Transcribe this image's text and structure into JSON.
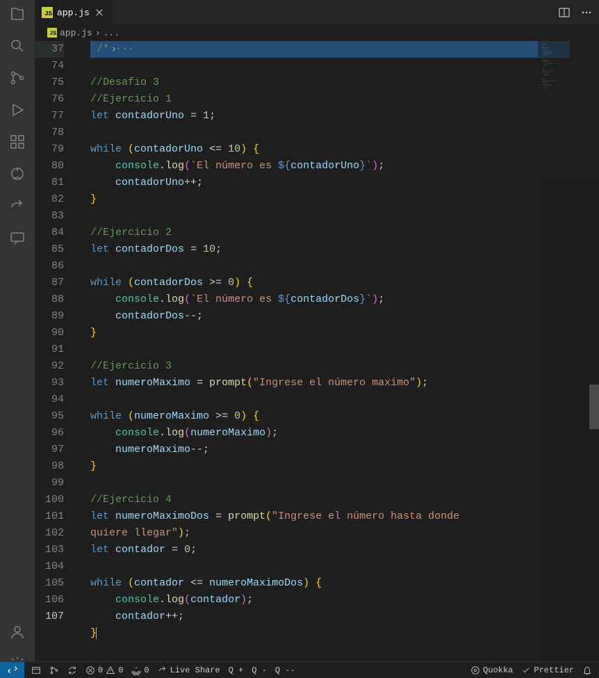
{
  "tab": {
    "name": "app.js"
  },
  "breadcrumb": {
    "file": "app.js",
    "sep": "›",
    "more": "..."
  },
  "lines": [
    {
      "n": 37,
      "tokens": [
        [
          "fold",
          "›"
        ],
        [
          "cm",
          " /* "
        ],
        [
          "cm",
          "···"
        ]
      ]
    },
    {
      "n": 74,
      "tokens": []
    },
    {
      "n": 75,
      "tokens": [
        [
          "cm",
          "//Desafio 3"
        ]
      ]
    },
    {
      "n": 76,
      "tokens": [
        [
          "cm",
          "//Ejercicio 1"
        ]
      ]
    },
    {
      "n": 77,
      "tokens": [
        [
          "kw",
          "let"
        ],
        [
          "p",
          " "
        ],
        [
          "var",
          "contadorUno"
        ],
        [
          "p",
          " = "
        ],
        [
          "num",
          "1"
        ],
        [
          "p",
          ";"
        ]
      ]
    },
    {
      "n": 78,
      "tokens": []
    },
    {
      "n": 79,
      "tokens": [
        [
          "kw",
          "while"
        ],
        [
          "p",
          " "
        ],
        [
          "br",
          "("
        ],
        [
          "var",
          "contadorUno"
        ],
        [
          "p",
          " <= "
        ],
        [
          "num",
          "10"
        ],
        [
          "br",
          ")"
        ],
        [
          "p",
          " "
        ],
        [
          "br",
          "{"
        ]
      ]
    },
    {
      "n": 80,
      "tokens": [
        [
          "p",
          "    "
        ],
        [
          "obj",
          "console"
        ],
        [
          "p",
          "."
        ],
        [
          "fn",
          "log"
        ],
        [
          "br2",
          "("
        ],
        [
          "str",
          "`El número es "
        ],
        [
          "kw",
          "${"
        ],
        [
          "tplv",
          "contadorUno"
        ],
        [
          "kw",
          "}"
        ],
        [
          "str",
          "`"
        ],
        [
          "br2",
          ")"
        ],
        [
          "p",
          ";"
        ]
      ]
    },
    {
      "n": 81,
      "tokens": [
        [
          "p",
          "    "
        ],
        [
          "var",
          "contadorUno"
        ],
        [
          "p",
          "++;"
        ]
      ]
    },
    {
      "n": 82,
      "tokens": [
        [
          "br",
          "}"
        ]
      ]
    },
    {
      "n": 83,
      "tokens": []
    },
    {
      "n": 84,
      "tokens": [
        [
          "cm",
          "//Ejercicio 2"
        ]
      ]
    },
    {
      "n": 85,
      "tokens": [
        [
          "kw",
          "let"
        ],
        [
          "p",
          " "
        ],
        [
          "var",
          "contadorDos"
        ],
        [
          "p",
          " = "
        ],
        [
          "num",
          "10"
        ],
        [
          "p",
          ";"
        ]
      ]
    },
    {
      "n": 86,
      "tokens": []
    },
    {
      "n": 87,
      "tokens": [
        [
          "kw",
          "while"
        ],
        [
          "p",
          " "
        ],
        [
          "br",
          "("
        ],
        [
          "var",
          "contadorDos"
        ],
        [
          "p",
          " >= "
        ],
        [
          "num",
          "0"
        ],
        [
          "br",
          ")"
        ],
        [
          "p",
          " "
        ],
        [
          "br",
          "{"
        ]
      ]
    },
    {
      "n": 88,
      "tokens": [
        [
          "p",
          "    "
        ],
        [
          "obj",
          "console"
        ],
        [
          "p",
          "."
        ],
        [
          "fn",
          "log"
        ],
        [
          "br2",
          "("
        ],
        [
          "str",
          "`El número es "
        ],
        [
          "kw",
          "${"
        ],
        [
          "tplv",
          "contadorDos"
        ],
        [
          "kw",
          "}"
        ],
        [
          "str",
          "`"
        ],
        [
          "br2",
          ")"
        ],
        [
          "p",
          ";"
        ]
      ]
    },
    {
      "n": 89,
      "tokens": [
        [
          "p",
          "    "
        ],
        [
          "var",
          "contadorDos"
        ],
        [
          "p",
          "--;"
        ]
      ]
    },
    {
      "n": 90,
      "tokens": [
        [
          "br",
          "}"
        ]
      ]
    },
    {
      "n": 91,
      "tokens": []
    },
    {
      "n": 92,
      "tokens": [
        [
          "cm",
          "//Ejercicio 3"
        ]
      ]
    },
    {
      "n": 93,
      "tokens": [
        [
          "kw",
          "let"
        ],
        [
          "p",
          " "
        ],
        [
          "var",
          "numeroMaximo"
        ],
        [
          "p",
          " = "
        ],
        [
          "fn",
          "prompt"
        ],
        [
          "br",
          "("
        ],
        [
          "str",
          "\"Ingrese el número maximo\""
        ],
        [
          "br",
          ")"
        ],
        [
          "p",
          ";"
        ]
      ]
    },
    {
      "n": 94,
      "tokens": []
    },
    {
      "n": 95,
      "tokens": [
        [
          "kw",
          "while"
        ],
        [
          "p",
          " "
        ],
        [
          "br",
          "("
        ],
        [
          "var",
          "numeroMaximo"
        ],
        [
          "p",
          " >= "
        ],
        [
          "num",
          "0"
        ],
        [
          "br",
          ")"
        ],
        [
          "p",
          " "
        ],
        [
          "br",
          "{"
        ]
      ]
    },
    {
      "n": 96,
      "tokens": [
        [
          "p",
          "    "
        ],
        [
          "obj",
          "console"
        ],
        [
          "p",
          "."
        ],
        [
          "fn",
          "log"
        ],
        [
          "br2",
          "("
        ],
        [
          "var",
          "numeroMaximo"
        ],
        [
          "br2",
          ")"
        ],
        [
          "p",
          ";"
        ]
      ]
    },
    {
      "n": 97,
      "tokens": [
        [
          "p",
          "    "
        ],
        [
          "var",
          "numeroMaximo"
        ],
        [
          "p",
          "--;"
        ]
      ]
    },
    {
      "n": 98,
      "tokens": [
        [
          "br",
          "}"
        ]
      ]
    },
    {
      "n": 99,
      "tokens": []
    },
    {
      "n": 100,
      "tokens": [
        [
          "cm",
          "//Ejercicio 4"
        ]
      ]
    },
    {
      "n": 101,
      "tokens": [
        [
          "kw",
          "let"
        ],
        [
          "p",
          " "
        ],
        [
          "var",
          "numeroMaximoDos"
        ],
        [
          "p",
          " = "
        ],
        [
          "fn",
          "prompt"
        ],
        [
          "br",
          "("
        ],
        [
          "str",
          "\"Ingrese el número hasta donde "
        ]
      ],
      "wrap": true
    },
    {
      "n": "",
      "tokens": [
        [
          "str",
          "quiere llegar\""
        ],
        [
          "br",
          ")"
        ],
        [
          "p",
          ";"
        ]
      ]
    },
    {
      "n": 102,
      "tokens": [
        [
          "kw",
          "let"
        ],
        [
          "p",
          " "
        ],
        [
          "var",
          "contador"
        ],
        [
          "p",
          " = "
        ],
        [
          "num",
          "0"
        ],
        [
          "p",
          ";"
        ]
      ]
    },
    {
      "n": 103,
      "tokens": []
    },
    {
      "n": 104,
      "tokens": [
        [
          "kw",
          "while"
        ],
        [
          "p",
          " "
        ],
        [
          "br",
          "("
        ],
        [
          "var",
          "contador"
        ],
        [
          "p",
          " <= "
        ],
        [
          "var",
          "numeroMaximoDos"
        ],
        [
          "br",
          ")"
        ],
        [
          "p",
          " "
        ],
        [
          "br",
          "{"
        ]
      ]
    },
    {
      "n": 105,
      "tokens": [
        [
          "p",
          "    "
        ],
        [
          "obj",
          "console"
        ],
        [
          "p",
          "."
        ],
        [
          "fn",
          "log"
        ],
        [
          "br2",
          "("
        ],
        [
          "var",
          "contador"
        ],
        [
          "br2",
          ")"
        ],
        [
          "p",
          ";"
        ]
      ]
    },
    {
      "n": 106,
      "tokens": [
        [
          "p",
          "    "
        ],
        [
          "var",
          "contador"
        ],
        [
          "p",
          "++;"
        ]
      ]
    },
    {
      "n": 107,
      "tokens": [
        [
          "br",
          "}"
        ]
      ],
      "cursor": true
    }
  ],
  "status": {
    "errors": "0",
    "warnings": "0",
    "port": "0",
    "liveshare": "Live Share",
    "qplus": "Q +",
    "qminus": "Q -",
    "qdash": "Q --",
    "quokka": "Quokka",
    "prettier": "Prettier"
  }
}
